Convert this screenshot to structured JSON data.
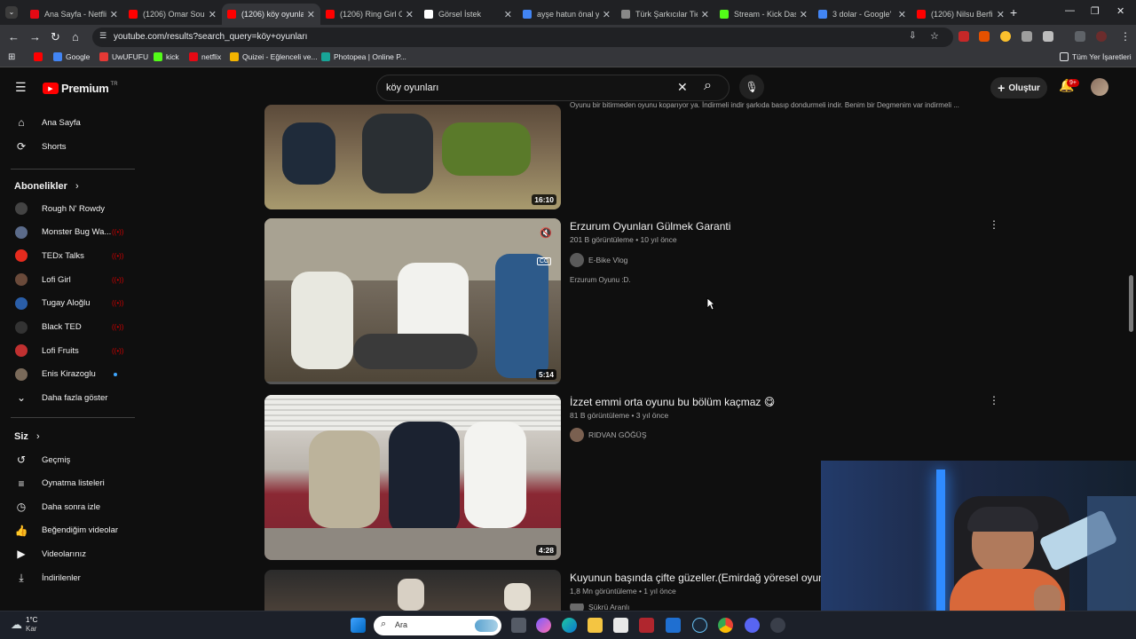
{
  "browser": {
    "tabs": [
      {
        "title": "Ana Sayfa - Netfli",
        "color": "#e50914"
      },
      {
        "title": "(1206) Omar Soul",
        "color": "#ff0000"
      },
      {
        "title": "(1206) köy oyunla",
        "color": "#ff0000"
      },
      {
        "title": "(1206) Ring Girl C",
        "color": "#ff0000"
      },
      {
        "title": "Görsel İstek",
        "color": "#ffffff"
      },
      {
        "title": "ayşe hatun önal y",
        "color": "#4285f4"
      },
      {
        "title": "Türk Şarkıcılar Tie",
        "color": "#888888"
      },
      {
        "title": "Stream - Kick Das",
        "color": "#53fc18"
      },
      {
        "title": "3 dolar - Google'",
        "color": "#4285f4"
      },
      {
        "title": "(1206) Nilsu Berfi",
        "color": "#ff0000"
      }
    ],
    "url": "youtube.com/results?search_query=köy+oyunları",
    "bookmarks": [
      {
        "label": "",
        "color": "#ff0000"
      },
      {
        "label": "Google",
        "color": "#4285f4"
      },
      {
        "label": "UwUFUFU",
        "color": "#e53935"
      },
      {
        "label": "kick",
        "color": "#53fc18"
      },
      {
        "label": "netflix",
        "color": "#e50914"
      },
      {
        "label": "Quizei - Eğlenceli ve...",
        "color": "#f4b400"
      },
      {
        "label": "Photopea | Online P...",
        "color": "#18a497"
      }
    ],
    "all_bookmarks": "Tüm Yer İşaretleri"
  },
  "youtube": {
    "logo_text": "Premium",
    "logo_badge": "TR",
    "search_query": "köy oyunları",
    "create_label": "Oluştur",
    "notif_count": "9+",
    "sidebar": {
      "home": "Ana Sayfa",
      "shorts": "Shorts",
      "subscriptions_header": "Abonelikler",
      "subscriptions": [
        {
          "name": "Rough N' Rowdy",
          "color": "#444",
          "live": false,
          "dot": false
        },
        {
          "name": "Monster Bug Wa...",
          "color": "#5b6b8a",
          "live": true,
          "dot": false
        },
        {
          "name": "TEDx Talks",
          "color": "#e62b1e",
          "live": true,
          "dot": false
        },
        {
          "name": "Lofi Girl",
          "color": "#6a4a3a",
          "live": true,
          "dot": false
        },
        {
          "name": "Tugay Aloğlu",
          "color": "#2a5ea8",
          "live": true,
          "dot": false
        },
        {
          "name": "Black TED",
          "color": "#333",
          "live": true,
          "dot": false
        },
        {
          "name": "Lofi Fruits",
          "color": "#c03030",
          "live": true,
          "dot": false
        },
        {
          "name": "Enis Kirazoglu",
          "color": "#7a6a5a",
          "live": false,
          "dot": true
        }
      ],
      "show_more": "Daha fazla göster",
      "you_header": "Siz",
      "you_items": [
        {
          "label": "Geçmiş",
          "icon": "history-icon"
        },
        {
          "label": "Oynatma listeleri",
          "icon": "playlists-icon"
        },
        {
          "label": "Daha sonra izle",
          "icon": "watch-later-icon"
        },
        {
          "label": "Beğendiğim videolar",
          "icon": "like-icon"
        },
        {
          "label": "Videolarınız",
          "icon": "your-videos-icon"
        },
        {
          "label": "İndirilenler",
          "icon": "downloads-icon"
        }
      ]
    },
    "results": [
      {
        "duration": "16:10",
        "desc": "Oyunu bir bitirmeden oyunu koparıyor ya. İndirmeli indir şarkıda basıp dondurmeli indir. Benim bir Degmenim var indirmeli ..."
      },
      {
        "title": "Erzurum Oyunları Gülmek Garanti",
        "meta": "201 B görüntüleme • 10 yıl önce",
        "channel": "E-Bike Vlog",
        "desc": "Erzurum Oyunu :D.",
        "duration": "5:14"
      },
      {
        "title": "İzzet emmi orta oyunu bu bölüm kaçmaz 😋",
        "meta": "81 B görüntüleme • 3 yıl önce",
        "channel": "RIDVAN GÖĞÜŞ",
        "duration": "4:28"
      },
      {
        "title": "Kuyunun başında çifte güzeller.(Emirdağ yöresel oyun",
        "meta": "1,8 Mn görüntüleme • 1 yıl önce",
        "channel": "Şükrü Aranlı"
      }
    ]
  },
  "taskbar": {
    "weather_temp": "1°C",
    "weather_desc": "Kar",
    "search_placeholder": "Ara"
  }
}
